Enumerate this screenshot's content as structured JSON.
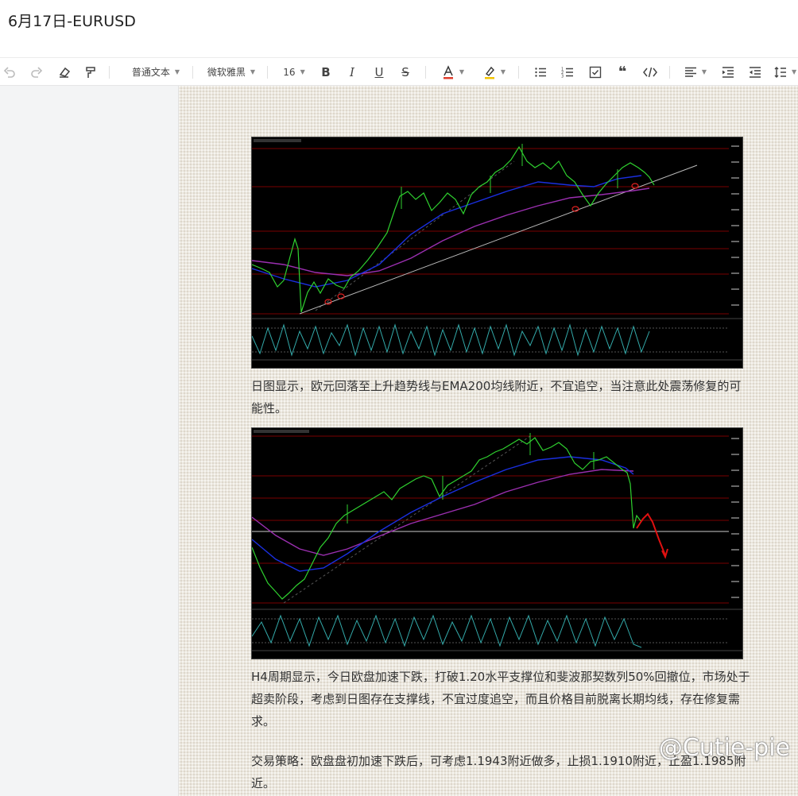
{
  "document": {
    "title": "6月17日-EURUSD"
  },
  "toolbar": {
    "paragraph_style": "普通文本",
    "font_family_value": "微软雅黑",
    "font_size_value": "16",
    "icons": [
      "undo-icon",
      "redo-icon",
      "eraser-icon",
      "format-painter-icon",
      "bold-icon",
      "italic-icon",
      "underline-icon",
      "strikethrough-icon",
      "font-color-icon",
      "highlight-icon",
      "bullet-list-icon",
      "numbered-list-icon",
      "checklist-icon",
      "quote-icon",
      "code-icon",
      "align-icon",
      "indent-icon",
      "outdent-icon",
      "line-height-icon"
    ],
    "font_color": "#e03e2d",
    "highlight_color": "#f2c300"
  },
  "content": {
    "para1": "日图显示，欧元回落至上升趋势线与EMA200均线附近，不宜追空，当注意此处震荡修复的可能性。",
    "para2": "H4周期显示，今日欧盘加速下跌，打破1.20水平支撑位和斐波那契数列50%回撤位，市场处于超卖阶段，考虑到日图存在支撑线，不宜过度追空，而且价格目前脱离长期均线，存在修复需求。",
    "para3": "交易策略：欧盘盘初加速下跌后，可考虑1.1943附近做多，止损1.1910附近，止盈1.1985附近。"
  },
  "watermark": "@Cutie-pie",
  "chart_colors": {
    "price": "#2fd12f",
    "ema_fast": "#1a2fe0",
    "ema_slow": "#9b2fb0",
    "levels": "#8b0000",
    "trend": "#bbbbbb"
  }
}
